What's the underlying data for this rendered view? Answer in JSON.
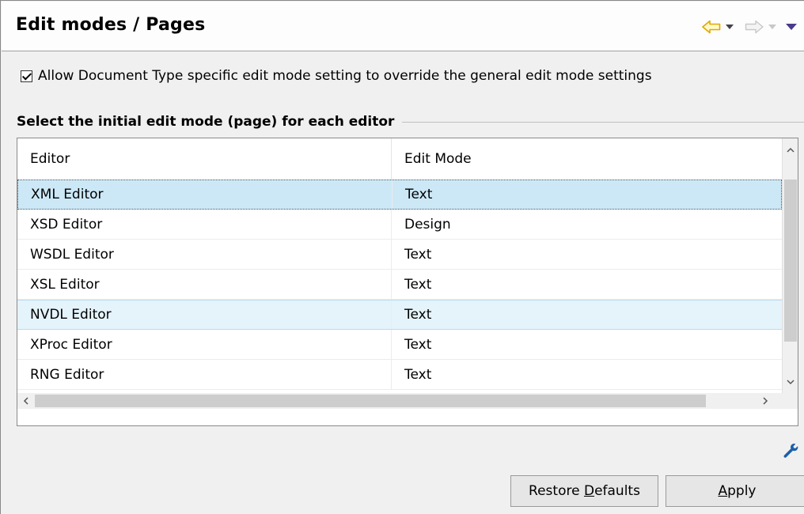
{
  "page": {
    "title": "Edit modes / Pages"
  },
  "navigation": {
    "icons": [
      "back-arrow-icon",
      "back-dropdown-icon",
      "forward-arrow-icon",
      "forward-dropdown-icon",
      "view-menu-icon"
    ]
  },
  "options": {
    "override_checkbox": {
      "checked": true,
      "label": "Allow Document Type specific edit mode setting to override the general edit mode settings"
    }
  },
  "editor_group": {
    "label": "Select the initial edit mode (page) for each editor"
  },
  "table": {
    "columns": [
      "Editor",
      "Edit Mode"
    ],
    "rows": [
      {
        "editor": "XML Editor",
        "mode": "Text",
        "state": "selected"
      },
      {
        "editor": "XSD Editor",
        "mode": "Design",
        "state": ""
      },
      {
        "editor": "WSDL Editor",
        "mode": "Text",
        "state": ""
      },
      {
        "editor": "XSL Editor",
        "mode": "Text",
        "state": ""
      },
      {
        "editor": "NVDL Editor",
        "mode": "Text",
        "state": "hover"
      },
      {
        "editor": "XProc Editor",
        "mode": "Text",
        "state": ""
      },
      {
        "editor": "RNG Editor",
        "mode": "Text",
        "state": ""
      }
    ]
  },
  "buttons": {
    "restore_defaults": {
      "before": "Restore ",
      "mnemonic": "D",
      "after": "efaults"
    },
    "apply": {
      "before": "",
      "mnemonic": "A",
      "after": "pply"
    }
  },
  "colors": {
    "selected_row": "#cce8f7",
    "hover_row": "#e5f3fb",
    "back_arrow": "#f0b000",
    "menu_triangle": "#4a3a8c",
    "wrench": "#1e5fa8"
  }
}
